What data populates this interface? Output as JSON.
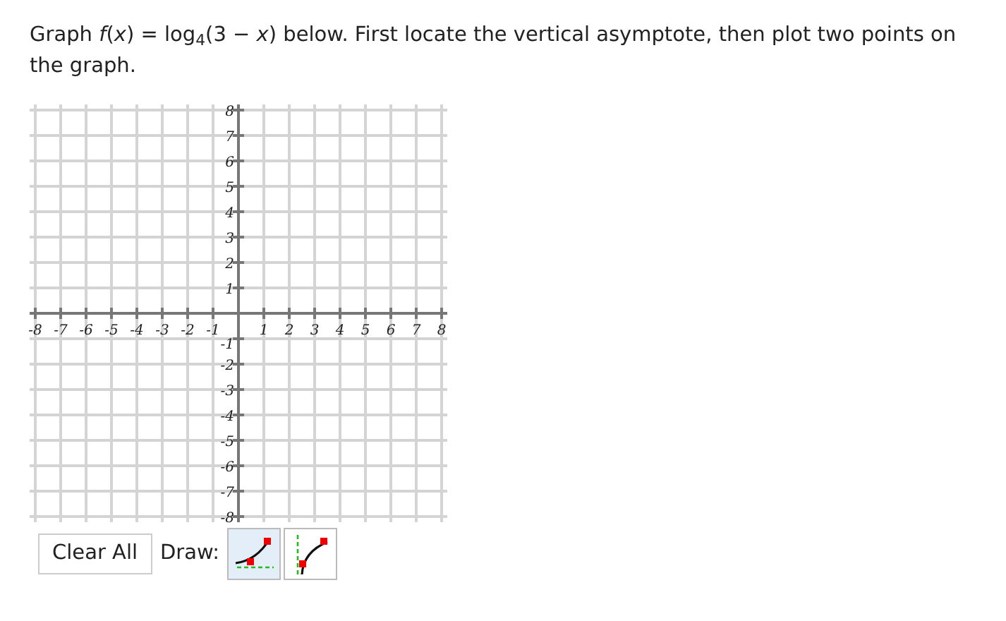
{
  "question": "Graph *f*(*x*) = log$_{4}$(3 − *x*) below. First locate the vertical asymptote, then plot two points on the graph.",
  "graph": {
    "x_labels": [
      "-8",
      "-7",
      "-6",
      "-5",
      "-4",
      "-3",
      "-2",
      "-1",
      "1",
      "2",
      "3",
      "4",
      "5",
      "6",
      "7",
      "8"
    ],
    "y_labels": [
      "8",
      "7",
      "6",
      "5",
      "4",
      "3",
      "2",
      "1",
      "-1",
      "-2",
      "-3",
      "-4",
      "-5",
      "-6",
      "-7",
      "-8"
    ]
  },
  "toolbar": {
    "clear_label": "Clear All",
    "draw_label": "Draw:",
    "tools": [
      {
        "kind": "exponential",
        "selected": true
      },
      {
        "kind": "logarithmic",
        "selected": false
      }
    ]
  }
}
